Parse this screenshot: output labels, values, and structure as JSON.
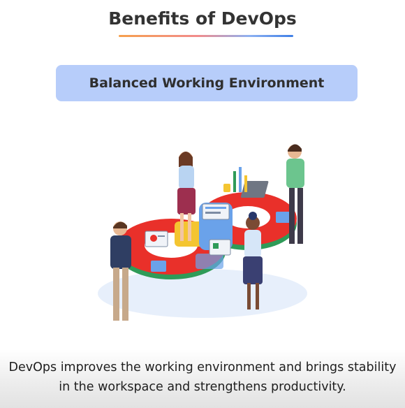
{
  "header": {
    "title": "Benefits of DevOps"
  },
  "section": {
    "label": "Balanced Working Environment"
  },
  "illustration": {
    "icon": "team-collaboration-illustration"
  },
  "caption": {
    "text": "DevOps improves the working environment and brings stability in the workspace and strengthens productivity."
  },
  "colors": {
    "accent": "#b7cdfa",
    "title": "#333333",
    "red": "#e9302a",
    "green": "#2f9b58",
    "yellow": "#f4c531",
    "blue": "#6aa2ea"
  }
}
